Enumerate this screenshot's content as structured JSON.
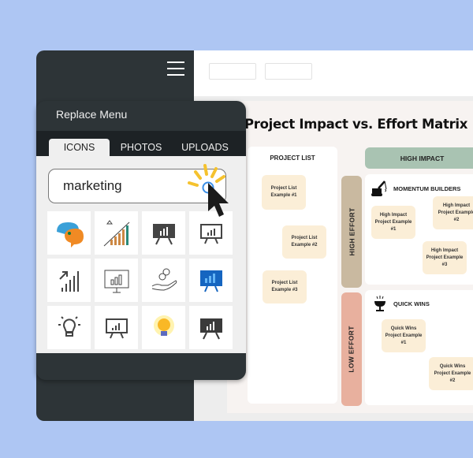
{
  "app": {
    "menu_icon": "hamburger-icon",
    "toolbar_boxes": [
      "",
      ""
    ]
  },
  "document": {
    "title": "Project Impact vs. Effort Matrix",
    "project_list": {
      "title": "PROJECT LIST",
      "items": [
        "Project List Example #1",
        "Project List Example #2",
        "Project List Example #3"
      ]
    },
    "effort_labels": {
      "high": "HIGH EFFORT",
      "low": "LOW EFFORT"
    },
    "impact_header": "HIGH IMPACT",
    "quadrants": [
      {
        "title": "MOMENTUM BUILDERS",
        "icon": "crane-icon",
        "items": [
          "High Impact Project Example #1",
          "High Impact Project Example #2",
          "High Impact Project Example #3"
        ]
      },
      {
        "title": "QUICK WINS",
        "icon": "trophy-icon",
        "items": [
          "Quick Wins Project Example #1",
          "Quick Wins Project Example #2"
        ]
      }
    ],
    "colors": {
      "high_effort": "#c9b9a0",
      "low_effort": "#e8b09e",
      "high_impact": "#a9c3b2",
      "card": "#fbeed7"
    }
  },
  "replace_menu": {
    "title": "Replace Menu",
    "tabs": [
      {
        "label": "ICONS",
        "active": true
      },
      {
        "label": "PHOTOS",
        "active": false
      },
      {
        "label": "UPLOADS",
        "active": false
      }
    ],
    "search": {
      "value": "marketing",
      "placeholder": ""
    },
    "icons": [
      "chat-eye-icon",
      "growth-chart-icon",
      "presentation-board-filled-icon",
      "presentation-board-outline-icon",
      "signal-growth-icon",
      "presentation-easel-icon",
      "hand-coins-icon",
      "blue-presentation-icon",
      "lightbulb-outline-icon",
      "presentation-chart-icon",
      "lightbulb-yellow-icon",
      "presentation-dark-icon"
    ]
  }
}
